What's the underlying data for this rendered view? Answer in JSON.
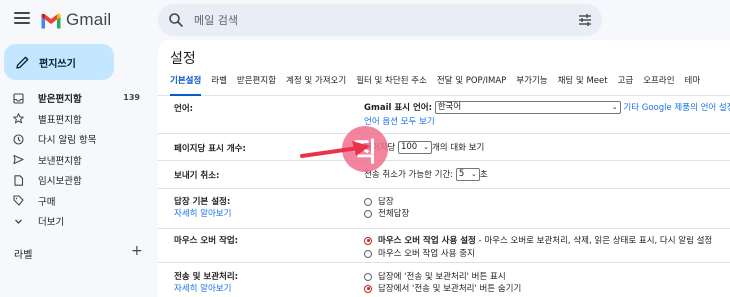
{
  "app": {
    "logo_text": "Gmail"
  },
  "search": {
    "placeholder": "메일 검색"
  },
  "compose": {
    "label": "편지쓰기"
  },
  "sidebar": {
    "items": [
      {
        "label": "받은편지함",
        "count": "139",
        "icon": "inbox-icon"
      },
      {
        "label": "별표편지함",
        "icon": "star-icon"
      },
      {
        "label": "다시 알림 항목",
        "icon": "clock-icon"
      },
      {
        "label": "보낸편지함",
        "icon": "send-icon"
      },
      {
        "label": "임시보관함",
        "icon": "draft-icon"
      },
      {
        "label": "구매",
        "icon": "tag-icon"
      },
      {
        "label": "더보기",
        "icon": "chevron-down-icon"
      }
    ],
    "labels_heading": "라벨",
    "labels_add": "+"
  },
  "settings": {
    "title": "설정",
    "tabs": [
      "기본설정",
      "라벨",
      "받은편지함",
      "계정 및 가져오기",
      "필터 및 차단된 주소",
      "전달 및 POP/IMAP",
      "부가기능",
      "채팅 및 Meet",
      "고급",
      "오프라인",
      "테마"
    ],
    "language": {
      "label": "언어:",
      "display_label": "Gmail 표시 언어:",
      "display_value": "한국어",
      "other_link": "기타 Google 제품의 언어 설정 변경",
      "options_link": "언어 옵션 모두 보기"
    },
    "page_size": {
      "label": "페이지당 표시 개수:",
      "prefix": "페이지당",
      "value": "100",
      "suffix": "개의 대화 보기"
    },
    "undo_send": {
      "label": "보내기 취소:",
      "prefix": "전송 취소가 가능한 기간:",
      "value": "5",
      "suffix": "초"
    },
    "reply_default": {
      "label": "답장 기본 설정:",
      "learn_more": "자세히 알아보기",
      "options": [
        "답장",
        "전체답장"
      ]
    },
    "hover_actions": {
      "label": "마우스 오버 작업:",
      "on_bold": "마우스 오버 작업 사용 설정",
      "on_rest": " - 마우스 오버로 보관처리, 삭제, 읽은 상태로 표시, 다시 알림 설정",
      "off": "마우스 오버 작업 사용 중지"
    },
    "send_archive": {
      "label": "전송 및 보관처리:",
      "learn_more": "자세히 알아보기",
      "options": [
        "답장에 '전송 및 보관처리' 버튼 표시",
        "답장에서 '전송 및 보관처리' 버튼 숨기기"
      ]
    }
  },
  "annotation": {
    "badge_text": "직"
  },
  "colors": {
    "accent": "#0b57d0",
    "compose_bg": "#c2e7ff",
    "annotation": "#e8344b"
  }
}
